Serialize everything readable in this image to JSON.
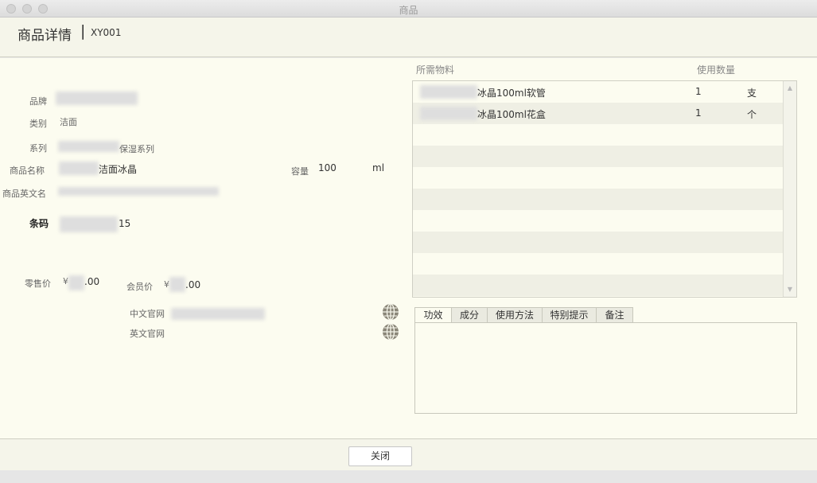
{
  "window": {
    "title": "商品"
  },
  "header": {
    "title": "商品详情",
    "separator": "|",
    "code": "XY001"
  },
  "form": {
    "brand_label": "品牌",
    "category_label": "类别",
    "category_value": "洁面",
    "series_label": "系列",
    "series_value": "保湿系列",
    "name_label": "商品名称",
    "name_value": "洁面冰晶",
    "capacity_label": "容量",
    "capacity_value": "100",
    "capacity_unit": "ml",
    "english_name_label": "商品英文名",
    "barcode_label": "条码",
    "barcode_value": "15",
    "retail_price_label": "零售价",
    "retail_currency": "¥",
    "retail_value": ".00",
    "member_price_label": "会员价",
    "member_currency": "¥",
    "member_value": ".00",
    "cn_site_label": "中文官网",
    "en_site_label": "英文官网"
  },
  "materials": {
    "header_material": "所需物料",
    "header_quantity": "使用数量",
    "rows": [
      {
        "name": "冰晶100ml软管",
        "qty": "1",
        "unit": "支"
      },
      {
        "name": "冰晶100ml花盒",
        "qty": "1",
        "unit": "个"
      }
    ]
  },
  "tabs": [
    {
      "label": "功效"
    },
    {
      "label": "成分"
    },
    {
      "label": "使用方法"
    },
    {
      "label": "特别提示"
    },
    {
      "label": "备注"
    }
  ],
  "footer": {
    "close_label": "关闭"
  }
}
